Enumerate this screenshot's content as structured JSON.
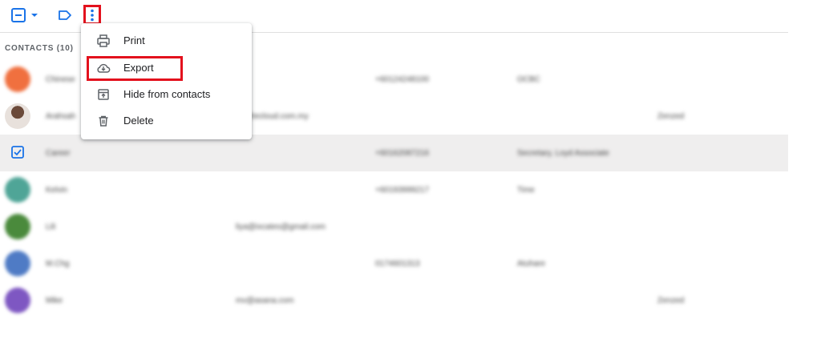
{
  "section": {
    "title": "CONTACTS (10)"
  },
  "menu": {
    "items": [
      {
        "label": "Print",
        "icon": "printer-icon"
      },
      {
        "label": "Export",
        "icon": "cloud-download-icon"
      },
      {
        "label": "Hide from contacts",
        "icon": "archive-icon"
      },
      {
        "label": "Delete",
        "icon": "trash-icon"
      }
    ]
  },
  "contacts": [
    {
      "name": "Chinese",
      "email": "",
      "phone": "+60124248100",
      "job": "OCBC",
      "labels": "",
      "avatar_color": "#f0703f"
    },
    {
      "name": "Arahsah",
      "email": "sh@tecloud.com.my",
      "phone": "",
      "job": "",
      "labels": "Zenzed",
      "avatar_color": "#6b4a3a"
    },
    {
      "name": "Career",
      "email": "",
      "phone": "+60162087216",
      "job": "Secretary, Loyd Associate",
      "labels": "",
      "avatar_color": "",
      "selected": true
    },
    {
      "name": "Kelvin",
      "email": "",
      "phone": "+60193999217",
      "job": "Time",
      "labels": "",
      "avatar_color": "#4fa597"
    },
    {
      "name": "Lili",
      "email": "liya@ixcates@gmail.com",
      "phone": "",
      "job": "",
      "labels": "",
      "avatar_color": "#4a8a3c"
    },
    {
      "name": "M.Chg",
      "email": "",
      "phone": "0174601313",
      "job": "Atuhare",
      "labels": "",
      "avatar_color": "#4f7bc5"
    },
    {
      "name": "Mike",
      "email": "mv@asana.com",
      "phone": "",
      "job": "",
      "labels": "Zenzed",
      "avatar_color": "#7e57c2"
    }
  ],
  "colors": {
    "accent": "#1a73e8",
    "highlight": "#e3111d"
  }
}
